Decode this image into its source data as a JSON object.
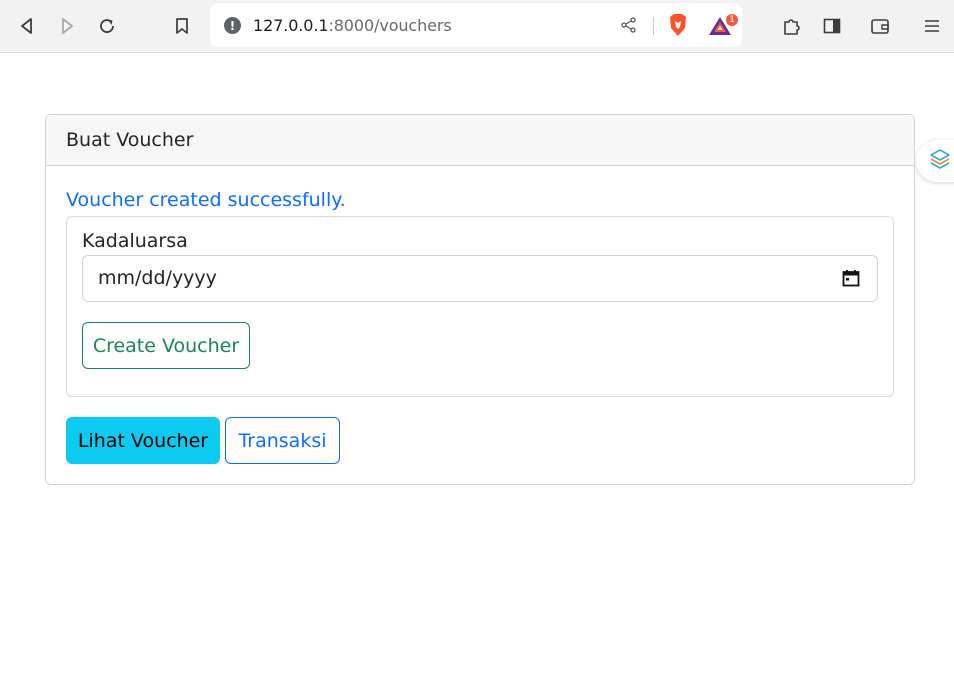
{
  "browser": {
    "url_host": "127.0.0.1",
    "url_rest": ":8000/vouchers",
    "notification_count": "1",
    "icons": {
      "back": "back-arrow-icon",
      "forward": "forward-arrow-icon",
      "reload": "reload-icon",
      "bookmark": "bookmark-icon",
      "site_info": "info-icon",
      "share": "share-icon",
      "shields": "brave-shields-icon",
      "rewards": "brave-rewards-icon",
      "extensions": "puzzle-icon",
      "sidebar": "sidebar-icon",
      "wallet": "wallet-icon",
      "menu": "hamburger-menu-icon"
    }
  },
  "page": {
    "card_title": "Buat Voucher",
    "success_message": "Voucher created successfully.",
    "form": {
      "expiry_label": "Kadaluarsa",
      "expiry_placeholder": "mm/dd/yyyy",
      "create_button": "Create Voucher"
    },
    "actions": {
      "view_vouchers": "Lihat Voucher",
      "transactions": "Transaksi"
    }
  },
  "colors": {
    "primary": "#0d6efd",
    "success": "#198754",
    "info": "#0dcaf0"
  }
}
